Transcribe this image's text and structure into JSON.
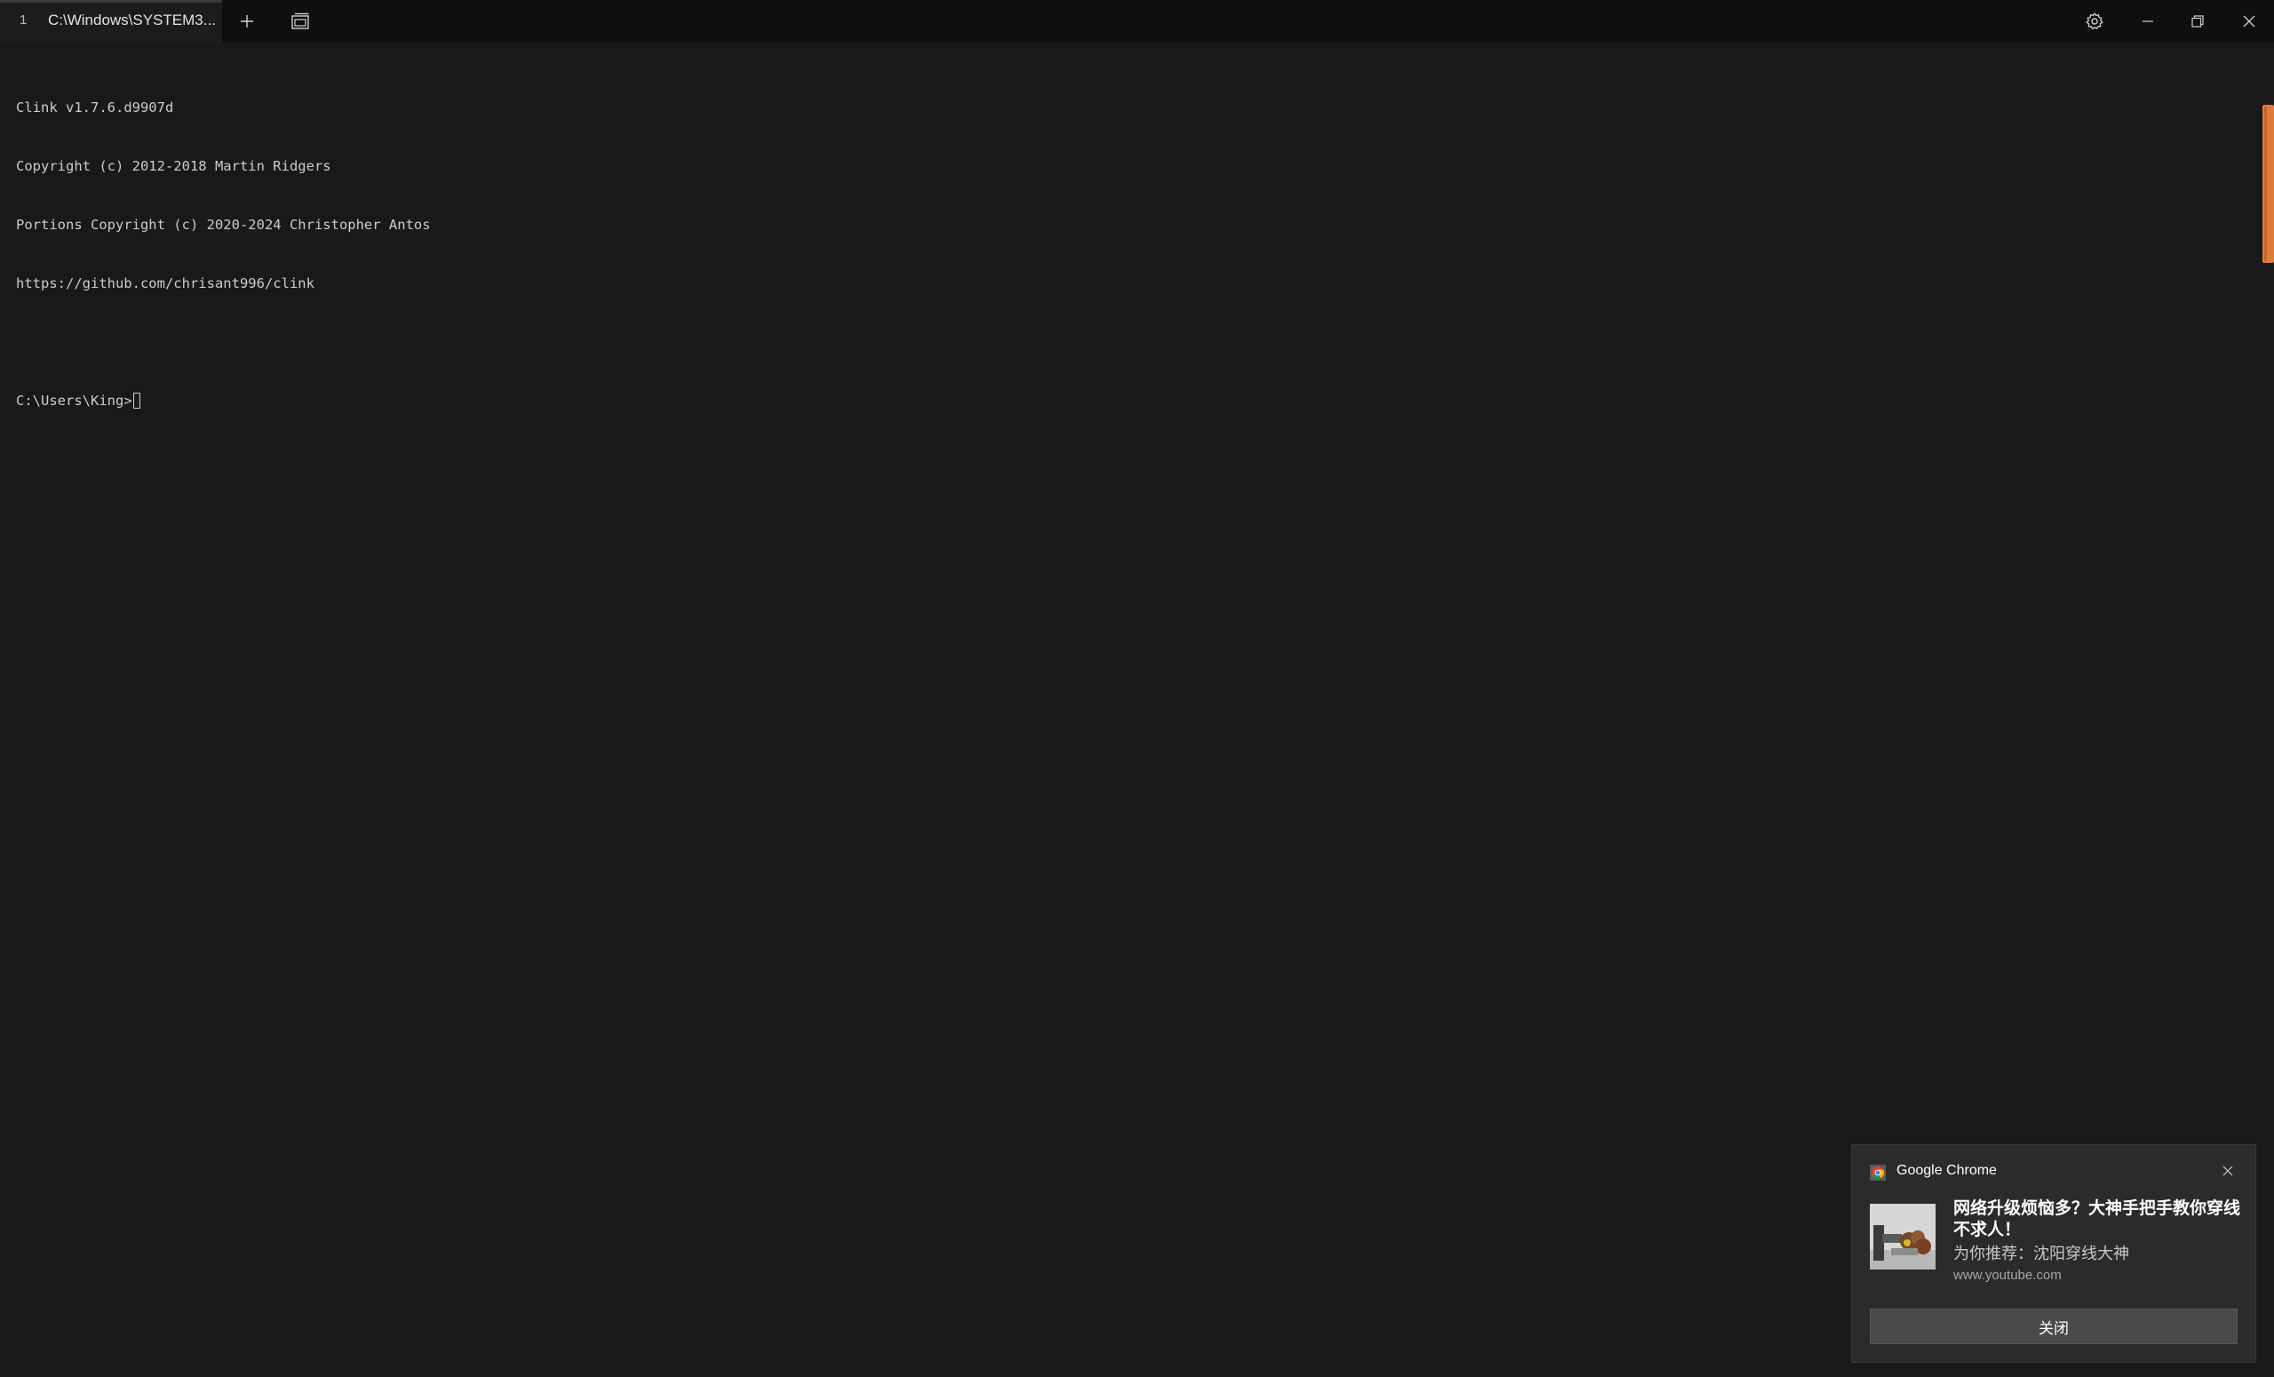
{
  "tab": {
    "index": "1",
    "title": "C:\\Windows\\SYSTEM3..."
  },
  "titlebar_icons": {
    "new_tab": "plus-icon",
    "tab_switcher": "tab-switcher-icon",
    "settings": "gear-icon",
    "minimize": "minimize-icon",
    "restore": "restore-icon",
    "close": "close-icon"
  },
  "terminal": {
    "lines": [
      "Clink v1.7.6.d9907d",
      "Copyright (c) 2012-2018 Martin Ridgers",
      "Portions Copyright (c) 2020-2024 Christopher Antos",
      "https://github.com/chrisant996/clink",
      "",
      "C:\\Users\\King>"
    ]
  },
  "colors": {
    "terminal_bg": "#191919",
    "titlebar_bg": "#0f0f0f",
    "scrollbar_thumb": "#e07a3a",
    "toast_bg": "#2b2b2b"
  },
  "toast": {
    "app_name": "Google Chrome",
    "app_icon": "chrome-icon",
    "title": "网络升级烦恼多？大神手把手教你穿线不求人！",
    "body": "为你推荐：沈阳穿线大神",
    "source": "www.youtube.com",
    "action_label": "关闭"
  }
}
